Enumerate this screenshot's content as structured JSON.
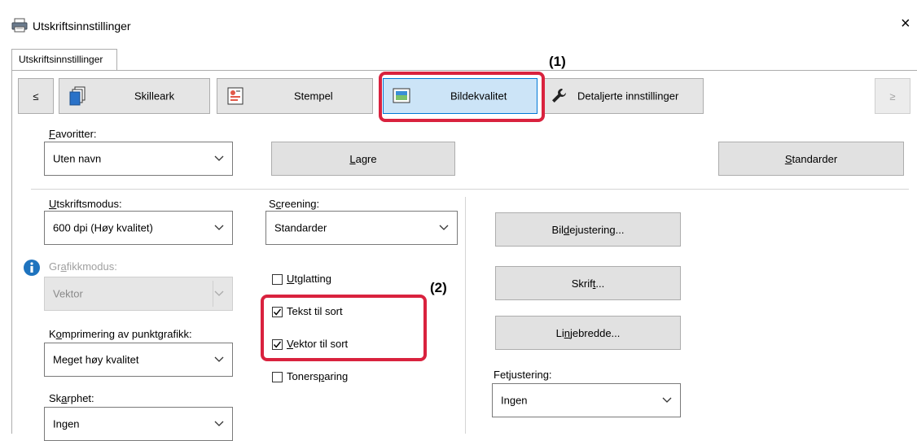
{
  "window": {
    "title": "Utskriftsinnstillinger",
    "close_glyph": "×",
    "accent": "#d9223e"
  },
  "outer_tab": {
    "label": "Utskriftsinnstillinger"
  },
  "toolbar": {
    "prev": "≤",
    "next": "≥",
    "tabs": [
      {
        "label": "Skilleark",
        "icon": "separator-pages-icon"
      },
      {
        "label": "Stempel",
        "icon": "stamp-icon"
      },
      {
        "label": "Bildekvalitet",
        "icon": "image-quality-icon",
        "selected": true
      },
      {
        "label": "Detaljerte innstillinger",
        "icon": "wrench-icon"
      }
    ]
  },
  "favorites": {
    "label_pre": "",
    "label_key": "F",
    "label_rest": "avoritter:",
    "value": "Uten navn",
    "save_pre": "",
    "save_key": "L",
    "save_rest": "agre",
    "default_pre": "",
    "default_key": "S",
    "default_rest": "tandarder"
  },
  "print_mode": {
    "label_pre": "",
    "label_key": "U",
    "label_rest": "tskriftsmodus:",
    "value": "600 dpi (Høy kvalitet)"
  },
  "graphics_mode": {
    "label_pre": "Gr",
    "label_key": "a",
    "label_rest": "fikkmodus:",
    "value": "Vektor"
  },
  "compression": {
    "label_pre": "K",
    "label_key": "o",
    "label_rest": "mprimering av punktgrafikk:",
    "value": "Meget høy kvalitet"
  },
  "sharpness": {
    "label_pre": "Sk",
    "label_key": "a",
    "label_rest": "rphet:",
    "value": "Ingen"
  },
  "screening": {
    "label_pre": "S",
    "label_key": "c",
    "label_rest": "reening:",
    "value": "Standarder"
  },
  "checkboxes": [
    {
      "pre": "",
      "key": "U",
      "rest": "tglatting",
      "checked": false
    },
    {
      "pre": "",
      "key": "",
      "rest": "Tekst til sort",
      "checked": true
    },
    {
      "pre": "",
      "key": "V",
      "rest": "ektor til sort",
      "checked": true
    },
    {
      "pre": "Toners",
      "key": "p",
      "rest": "aring",
      "checked": false
    }
  ],
  "buttons": {
    "image_adjust": {
      "pre": "Bil",
      "key": "d",
      "rest": "ejustering..."
    },
    "font": {
      "pre": "Skrif",
      "key": "t",
      "rest": "..."
    },
    "line_width": {
      "pre": "Li",
      "key": "n",
      "rest": "jebredde..."
    }
  },
  "fine_adjust": {
    "label": "Fetjustering:",
    "value": "Ingen"
  },
  "annotations": {
    "one": "(1)",
    "two": "(2)"
  }
}
